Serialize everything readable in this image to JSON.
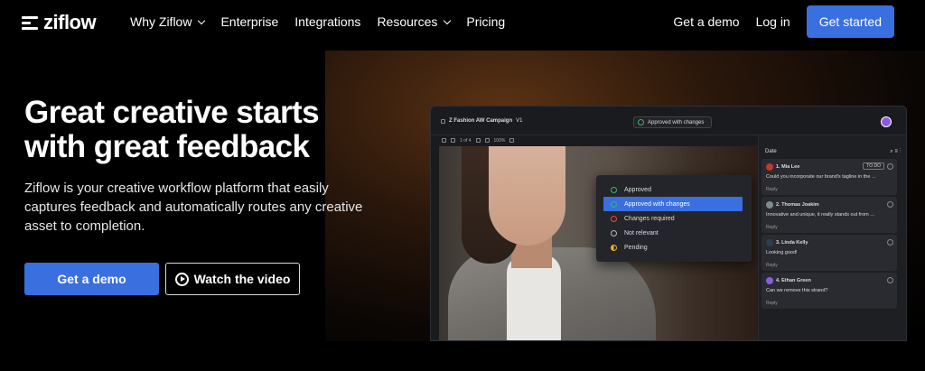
{
  "nav": {
    "logo": "ziflow",
    "links": [
      {
        "label": "Why Ziflow",
        "dropdown": true
      },
      {
        "label": "Enterprise",
        "dropdown": false
      },
      {
        "label": "Integrations",
        "dropdown": false
      },
      {
        "label": "Resources",
        "dropdown": true
      },
      {
        "label": "Pricing",
        "dropdown": false
      }
    ],
    "get_demo": "Get a demo",
    "login": "Log in",
    "get_started": "Get started"
  },
  "hero": {
    "headline": "Great creative starts with great feedback",
    "subtext": "Ziflow is your creative workflow platform that easily captures feedback and automatically routes any creative asset to completion.",
    "demo_button": "Get a demo",
    "video_button": "Watch the video"
  },
  "app": {
    "project": "Z  Fashion AW Campaign",
    "version": "V1",
    "status_pill": "Approved with changes",
    "page_indicator": "1 of 4",
    "zoom": "100%",
    "status_menu": [
      {
        "label": "Approved",
        "color": "#3bb56a"
      },
      {
        "label": "Approved with changes",
        "color": "#3bb56a"
      },
      {
        "label": "Changes required",
        "color": "#e24b4b"
      },
      {
        "label": "Not relevant",
        "color": "#bbbbbb"
      },
      {
        "label": "Pending",
        "color": "#f0b030"
      }
    ],
    "panel_sort": "Date",
    "comments": [
      {
        "num_name": "1. Mia Lee",
        "text": "Could you incorporate our brand's tagline in the ...",
        "reply": "Reply",
        "badge": "TO DO",
        "avatar_color": "#c0392b"
      },
      {
        "num_name": "2. Thomas Joakim",
        "text": "Innovative and unique, it really stands out from ...",
        "reply": "Reply",
        "badge": "",
        "avatar_color": "#7f8c8d"
      },
      {
        "num_name": "3. Linda Kelly",
        "text": "Looking good!",
        "reply": "Reply",
        "badge": "",
        "avatar_color": "#2c3e50"
      },
      {
        "num_name": "4. Ethan Green",
        "text": "Can we remove this strand?",
        "reply": "Reply",
        "badge": "",
        "avatar_color": "#8c5ae0"
      }
    ],
    "accent": "#3a6fe0"
  }
}
